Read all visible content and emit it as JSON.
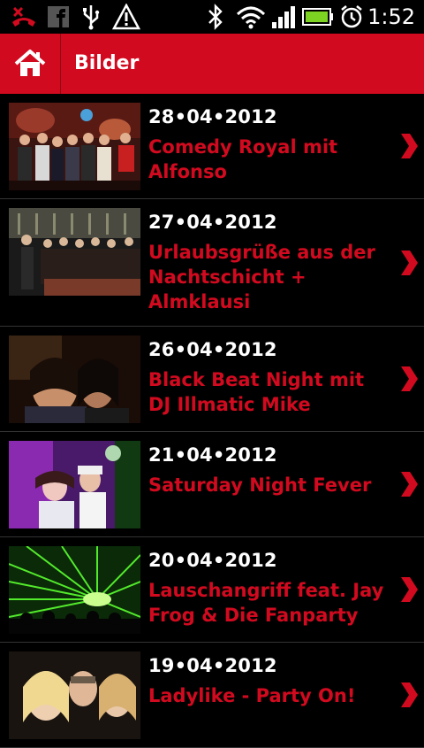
{
  "status": {
    "time": "1:52"
  },
  "appbar": {
    "title": "Bilder",
    "home_icon": "home-icon"
  },
  "colors": {
    "brand_red": "#d20a1f",
    "background": "#000000",
    "text": "#ffffff"
  },
  "items": [
    {
      "date": "28•04•2012",
      "title": "Comedy Royal mit Alfonso"
    },
    {
      "date": "27•04•2012",
      "title": "Urlaubsgrüße aus der Nachtschicht + Almklausi"
    },
    {
      "date": "26•04•2012",
      "title": "Black Beat Night mit DJ Illmatic Mike"
    },
    {
      "date": "21•04•2012",
      "title": "Saturday Night Fever"
    },
    {
      "date": "20•04•2012",
      "title": "Lauschangriff feat. Jay Frog & Die Fanparty"
    },
    {
      "date": "19•04•2012",
      "title": "Ladylike - Party On!"
    }
  ]
}
